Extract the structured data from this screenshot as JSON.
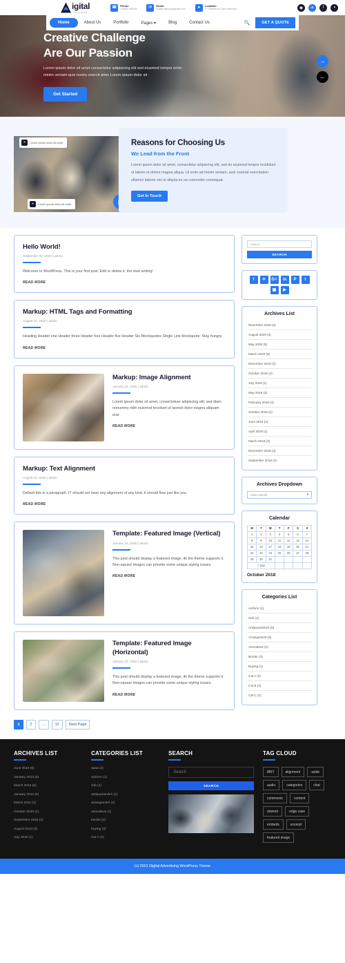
{
  "topbar": {
    "logo_text": "igital",
    "logo_sub": "advertising",
    "contacts": [
      {
        "icon": "phone-icon",
        "label": "Phone",
        "value": "+00803 456 89"
      },
      {
        "icon": "envelope-icon",
        "label": "Email",
        "value": "Digital.agency@gmail.com"
      },
      {
        "icon": "map-pin-icon",
        "label": "Location",
        "value": "17 Franklin st, San Francisco"
      }
    ],
    "socials": [
      {
        "name": "instagram-icon",
        "glyph": "◉"
      },
      {
        "name": "twitter-icon",
        "glyph": "✈"
      },
      {
        "name": "facebook-icon",
        "glyph": "f"
      },
      {
        "name": "behance-icon",
        "glyph": "◑"
      }
    ]
  },
  "nav": {
    "items": [
      {
        "label": "Home",
        "active": true
      },
      {
        "label": "About Us",
        "active": false
      },
      {
        "label": "Portfolio",
        "active": false
      },
      {
        "label": "Pages ▾",
        "active": false
      },
      {
        "label": "Blog",
        "active": false
      },
      {
        "label": "Contact Us",
        "active": false
      }
    ],
    "search_icon": "search-icon",
    "cta_label": "GET A QUOTE"
  },
  "hero": {
    "title_line1": "Creative Challenge",
    "title_line2": "Are Our Passion",
    "subtitle": "Lorem ipsum dolor sit amet consectetur adipisicing elit sed eiusmod tempor enim minim veniam quis nostru exercit ation Lorem ipsum dolor sit",
    "button": "Get Started",
    "next_arrow": "→",
    "prev_arrow": "←"
  },
  "reasons": {
    "heading": "Reasons for Choosing Us",
    "subheading": "We Lead from the Front",
    "paragraph": "Lorem ipsum dolor sit amet, consectetur adipiscing elit, sed do eiusmod tempor incididunt ut labore et dolore magna aliqua. Ut enim ad minim veniam, quis nostrud exercitation ullamco laboris nisi ut aliquip ex ea commodo consequat.",
    "button": "Get In Touch",
    "bubble1": "Lorem ipsum dolor sit amet",
    "bubble2": "Lorem ipsum dolor sit amet",
    "play_icon": "play-icon"
  },
  "posts": [
    {
      "title": "Hello World!",
      "meta": "September 22, 2020 | admin",
      "body": "Welcome to WordPress. This is your first post, Edit or delete it, the start writing!",
      "more": "READ MORE",
      "has_image": false
    },
    {
      "title": "Markup: HTML Tags and Formatting",
      "meta": "August 22, 2020 | admin",
      "body": "Heading Header one Header three Header four Header five Header Six Blockquotes Single Line blockquote: Stay hungry.",
      "more": "READ MORE",
      "has_image": false
    },
    {
      "title": "Markup: Image Alignment",
      "meta": "January 22, 2020 | admin",
      "body": "Lorem ipsum dolor sit amet, consectetuer adipiscing elit, sed diam nonummy nibh euismod tincidunt ut laoreet dolor magna aliquam erat",
      "more": "READ MORE",
      "has_image": true,
      "thumb_class": "t1"
    },
    {
      "title": "Markup: Text Alignment",
      "meta": "August 22, 2020 | admin",
      "body": "Default this is a paragraph. IT should not have any alignment of any kind. It should flow just like you.",
      "more": "READ MORE",
      "has_image": false
    },
    {
      "title": "Template: Featured Image (Vertical)",
      "meta": "January 22, 2020 | admin",
      "body": "This post should display a featured image, ith the theme supports it. Non-square images can provide some unique styling issues.",
      "more": "READ MORE",
      "has_image": true,
      "thumb_class": "t2"
    },
    {
      "title": "Template: Featured Image (Horizontal)",
      "meta": "January 22, 2020 | admin",
      "body": "This post should display a featured image, ith the theme supports it. Non-square images can provide some unique styling issues.",
      "more": "READ MORE",
      "has_image": true,
      "thumb_class": "t3"
    }
  ],
  "sidebar": {
    "search": {
      "placeholder": "Search...",
      "button": "SEARCH"
    },
    "socials": [
      {
        "name": "facebook-icon",
        "glyph": "f"
      },
      {
        "name": "twitter-icon",
        "glyph": "✈"
      },
      {
        "name": "google-plus-icon",
        "glyph": "G+"
      },
      {
        "name": "linkedin-icon",
        "glyph": "in"
      },
      {
        "name": "pinterest-icon",
        "glyph": "P"
      },
      {
        "name": "tumblr-icon",
        "glyph": "t"
      },
      {
        "name": "instagram-icon",
        "glyph": "▣"
      },
      {
        "name": "youtube-icon",
        "glyph": "▶"
      }
    ],
    "archives": {
      "title": "Archives List",
      "items": [
        "November 2020 (2)",
        "August 2020 (3)",
        "May 2020 (5)",
        "March 2020 (6)",
        "December 2019 (2)",
        "October 2019 (4)",
        "July 2019 (1)",
        "May 2019 (3)",
        "February 2019 (4)",
        "October 2019 (2)",
        "June 2019 (4)",
        "April 2019 (1)",
        "March 2019 (3)",
        "December 2018 (4)",
        "September 2018 (2)"
      ]
    },
    "archives_dropdown": {
      "title": "Archives Dropdown",
      "selected": "Select Month"
    },
    "calendar": {
      "title": "Calendar",
      "weekdays": [
        "M",
        "T",
        "W",
        "T",
        "F",
        "S",
        "S"
      ],
      "weeks": [
        [
          "1",
          "2",
          "3",
          "4",
          "5",
          "6",
          "7"
        ],
        [
          "8",
          "9",
          "10",
          "11",
          "12",
          "13",
          "14"
        ],
        [
          "15",
          "16",
          "17",
          "18",
          "19",
          "20",
          "21"
        ],
        [
          "22",
          "23",
          "24",
          "25",
          "26",
          "27",
          "28"
        ],
        [
          "29",
          "30",
          "31",
          "",
          "",
          "",
          ""
        ]
      ],
      "prev_label": "« Sep",
      "month_label": "October 2018"
    },
    "categories": {
      "title": "Categories List",
      "items": [
        "Aciform (1)",
        "Sub (1)",
        "Antiquarianism (5)",
        "Arrangement (6)",
        "Asmodeus (2)",
        "Broder (4)",
        "Buying (1)",
        "Cat A (3)",
        "Cat B (4)",
        "Cat C (2)"
      ]
    }
  },
  "pagination": {
    "pages": [
      "1",
      "2",
      "...",
      "12"
    ],
    "next_label": "Next Page",
    "active": "1"
  },
  "footer": {
    "archives": {
      "title": "ARCHIVES LIST",
      "items": [
        "June 2019 (5)",
        "January  2013 (5)",
        "March 2012 (5)",
        "January  2012 (6)",
        "March  2011 (1)",
        "October 2010 (1)",
        "September 2010 (2)",
        "August 2010 (3)",
        "July 2010 (1)"
      ]
    },
    "categories": {
      "title": "CATEGORIES LIST",
      "items": [
        "aaaa (4)",
        "aciform (1)",
        "sub (1)",
        "antiquarianism (1)",
        "arrangement (1)",
        "asmodeus (1)",
        "border (2)",
        "buying (3)",
        "Cat A (1)"
      ]
    },
    "search": {
      "title": "SEARCH",
      "placeholder": "Search",
      "button": "SEARCH"
    },
    "tagcloud": {
      "title": "TAG CLOUD",
      "tags": [
        "8BIT",
        "alignment",
        "aside",
        "audio",
        "categories",
        "chat",
        "comments",
        "content",
        "dowork",
        "edge case",
        "embeds",
        "excerpt",
        "featured image"
      ]
    },
    "copyright": "(c) 2021 Digital Advertising  WordPress Theme"
  },
  "colors": {
    "accent": "#2979f0",
    "dark": "#141414",
    "panel": "#e9f0fd"
  }
}
